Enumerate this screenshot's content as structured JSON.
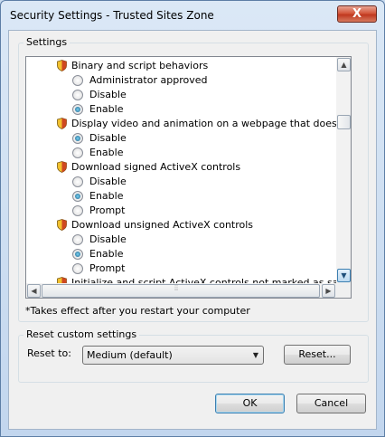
{
  "window": {
    "title": "Security Settings - Trusted Sites Zone",
    "close_label": "X"
  },
  "settings": {
    "group_label": "Settings",
    "items": [
      {
        "type": "category",
        "label": "Binary and script behaviors"
      },
      {
        "type": "option",
        "label": "Administrator approved",
        "checked": false
      },
      {
        "type": "option",
        "label": "Disable",
        "checked": false
      },
      {
        "type": "option",
        "label": "Enable",
        "checked": true
      },
      {
        "type": "category",
        "label": "Display video and animation on a webpage that does not use"
      },
      {
        "type": "option",
        "label": "Disable",
        "checked": true
      },
      {
        "type": "option",
        "label": "Enable",
        "checked": false
      },
      {
        "type": "category",
        "label": "Download signed ActiveX controls"
      },
      {
        "type": "option",
        "label": "Disable",
        "checked": false
      },
      {
        "type": "option",
        "label": "Enable",
        "checked": true
      },
      {
        "type": "option",
        "label": "Prompt",
        "checked": false
      },
      {
        "type": "category",
        "label": "Download unsigned ActiveX controls"
      },
      {
        "type": "option",
        "label": "Disable",
        "checked": false
      },
      {
        "type": "option",
        "label": "Enable",
        "checked": true
      },
      {
        "type": "option",
        "label": "Prompt",
        "checked": false
      },
      {
        "type": "category",
        "label": "Initialize and script ActiveX controls not marked as safe for s"
      }
    ],
    "note": "*Takes effect after you restart your computer"
  },
  "reset": {
    "group_label": "Reset custom settings",
    "reset_to_label": "Reset to:",
    "selected_level": "Medium (default)",
    "reset_button": "Reset..."
  },
  "buttons": {
    "ok": "OK",
    "cancel": "Cancel"
  },
  "colors": {
    "shield_yellow": "#f2c12e",
    "shield_red": "#c8321e",
    "radio_dot": "#1b5f8a"
  },
  "icons": {
    "category": "shield-icon",
    "scroll_up": "arrow-up-icon",
    "scroll_down": "arrow-down-icon",
    "scroll_left": "arrow-left-icon",
    "scroll_right": "arrow-right-icon",
    "dropdown": "chevron-down-icon"
  }
}
